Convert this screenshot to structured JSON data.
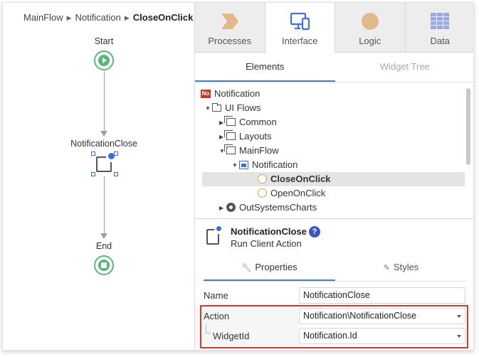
{
  "breadcrumb": {
    "items": [
      "MainFlow",
      "Notification"
    ],
    "current": "CloseOnClick"
  },
  "flow": {
    "start_label": "Start",
    "action_label": "NotificationClose",
    "end_label": "End"
  },
  "top_tabs": [
    {
      "label": "Processes",
      "icon": "processes-chevron-icon"
    },
    {
      "label": "Interface",
      "icon": "interface-devices-icon",
      "active": true
    },
    {
      "label": "Logic",
      "icon": "logic-circle-icon"
    },
    {
      "label": "Data",
      "icon": "data-grid-icon"
    }
  ],
  "sub_tabs": [
    {
      "label": "Elements",
      "active": true
    },
    {
      "label": "Widget Tree",
      "active": false
    }
  ],
  "tree": [
    {
      "label": "Notification",
      "icon": "module-no-icon",
      "icon_text": "No"
    },
    {
      "label": "UI Flows",
      "icon": "folder-icon",
      "expanded": true
    },
    {
      "label": "Common",
      "icon": "ui-flow-icon"
    },
    {
      "label": "Layouts",
      "icon": "ui-flow-icon"
    },
    {
      "label": "MainFlow",
      "icon": "ui-flow-icon",
      "expanded": true
    },
    {
      "label": "Notification",
      "icon": "screen-block-icon",
      "expanded": true
    },
    {
      "label": "CloseOnClick",
      "icon": "client-action-icon",
      "selected": true
    },
    {
      "label": "OpenOnClick",
      "icon": "client-action-icon"
    },
    {
      "label": "OutSystemsCharts",
      "icon": "dependency-gear-icon"
    }
  ],
  "properties_header": {
    "title": "NotificationClose",
    "subtitle": "Run Client Action",
    "help_text": "?"
  },
  "prop_tabs": [
    {
      "label": "Properties",
      "icon": "wrench-icon",
      "active": true
    },
    {
      "label": "Styles",
      "icon": "brush-icon",
      "active": false
    }
  ],
  "properties": {
    "name": {
      "label": "Name",
      "value": "NotificationClose"
    },
    "action": {
      "label": "Action",
      "value": "Notification\\NotificationClose"
    },
    "widget_id": {
      "label": "WidgetId",
      "value": "Notification.Id"
    }
  },
  "colors": {
    "accent_blue": "#3d6de8",
    "start_end_green": "#55b776",
    "logic_orange": "#e2b98a",
    "highlight_red": "#d0392b",
    "tab_underline": "#4a7fd6"
  }
}
